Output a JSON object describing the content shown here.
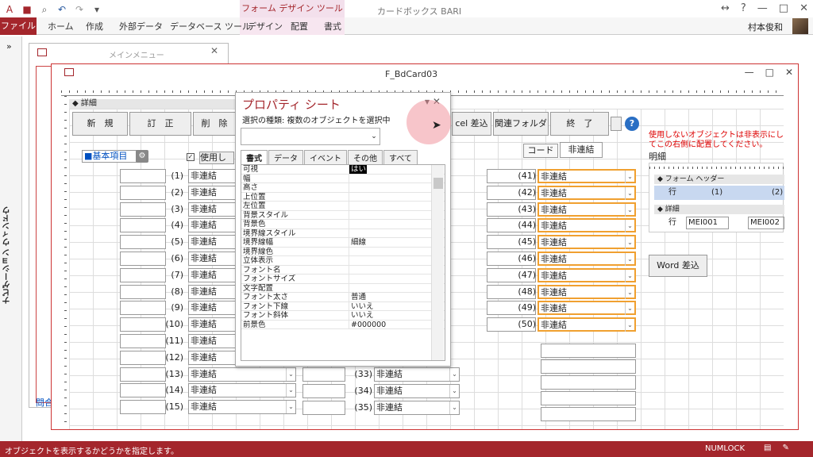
{
  "app": {
    "title": "カードボックス BARI",
    "context_tool": "フォーム デザイン ツール",
    "user": "村本俊和"
  },
  "ribbon_tabs": [
    "ファイル",
    "ホーム",
    "作成",
    "外部データ",
    "データベース ツール",
    "デザイン",
    "配置",
    "書式"
  ],
  "nav": {
    "label": "ナビゲーション ウィンドウ",
    "toggle": "»"
  },
  "main_menu": {
    "title": "メインメニュー",
    "link": "問合"
  },
  "form": {
    "title": "F_BdCard03",
    "detail_label": "詳細",
    "buttons": [
      "新　規",
      "訂　正",
      "削　除",
      "cel 差込",
      "関連フォルダ",
      "終　了"
    ],
    "kihon_label": "■基本項目",
    "use_label": "使用しな",
    "tabs": [
      "コード",
      "非連結"
    ],
    "note": "使用しないオブジェクトは非表示にしてこの右側に配置してください。",
    "meisai": "明細",
    "subform_header": "フォーム ヘッダー",
    "subform_detail": "詳細",
    "subform_row1": [
      "行",
      "(1)",
      "(2)"
    ],
    "subform_row2": [
      "行",
      "MEI001",
      "MEI002"
    ],
    "word_btn": "Word 差込",
    "combo_text": "非連結",
    "left_rows": [
      "(1)",
      "(2)",
      "(3)",
      "(4)",
      "(5)",
      "(6)",
      "(7)",
      "(8)",
      "(9)",
      "(10)",
      "(11)",
      "(12)",
      "(13)",
      "(14)",
      "(15)"
    ],
    "mid_rows": [
      "(33)",
      "(34)",
      "(35)"
    ],
    "right_rows": [
      "(41)",
      "(42)",
      "(43)",
      "(44)",
      "(45)",
      "(46)",
      "(47)",
      "(48)",
      "(49)",
      "(50)"
    ]
  },
  "property_sheet": {
    "title": "プロパティ シート",
    "selection_type": "選択の種類: 複数のオブジェクトを選択中",
    "tabs": [
      "書式",
      "データ",
      "イベント",
      "その他",
      "すべて"
    ],
    "rows": [
      {
        "name": "可視",
        "value": "はい"
      },
      {
        "name": "幅",
        "value": ""
      },
      {
        "name": "高さ",
        "value": ""
      },
      {
        "name": "上位置",
        "value": ""
      },
      {
        "name": "左位置",
        "value": ""
      },
      {
        "name": "背景スタイル",
        "value": ""
      },
      {
        "name": "背景色",
        "value": ""
      },
      {
        "name": "境界線スタイル",
        "value": ""
      },
      {
        "name": "境界線幅",
        "value": "細線"
      },
      {
        "name": "境界線色",
        "value": ""
      },
      {
        "name": "立体表示",
        "value": ""
      },
      {
        "name": "フォント名",
        "value": ""
      },
      {
        "name": "フォントサイズ",
        "value": ""
      },
      {
        "name": "文字配置",
        "value": ""
      },
      {
        "name": "フォント太さ",
        "value": "普通"
      },
      {
        "name": "フォント下線",
        "value": "いいえ"
      },
      {
        "name": "フォント斜体",
        "value": "いいえ"
      },
      {
        "name": "前景色",
        "value": "#000000"
      }
    ]
  },
  "status": {
    "text": "オブジェクトを表示するかどうかを指定します。",
    "numlock": "NUMLOCK"
  },
  "colors": {
    "accent": "#a4262c",
    "selection": "#f0a030"
  }
}
